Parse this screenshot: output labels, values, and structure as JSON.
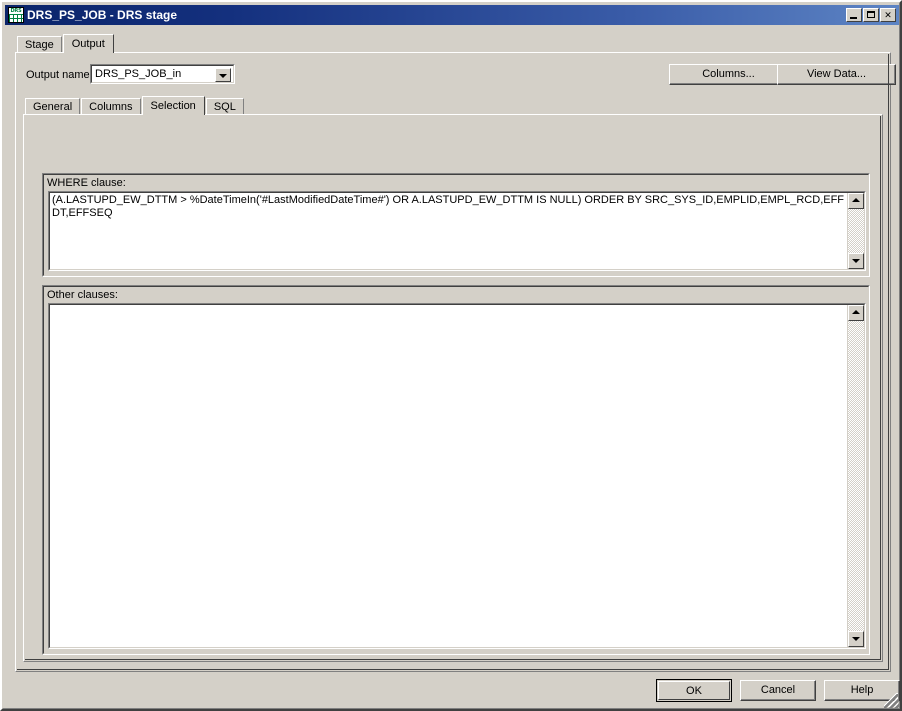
{
  "window": {
    "title": "DRS_PS_JOB - DRS stage",
    "icon": "drs-grid-icon",
    "minimize_label": "Minimize",
    "maximize_label": "Maximize",
    "close_label": "✕"
  },
  "outer_tabs": [
    {
      "label": "Stage",
      "active": false
    },
    {
      "label": "Output",
      "active": true
    }
  ],
  "output_row": {
    "label": "Output name:",
    "combo_value": "DRS_PS_JOB_in",
    "combo_placeholder": "Output name",
    "columns_button": "Columns...",
    "view_data_button": "View Data..."
  },
  "inner_tabs": [
    {
      "label": "General",
      "active": false
    },
    {
      "label": "Columns",
      "active": false
    },
    {
      "label": "Selection",
      "active": true
    },
    {
      "label": "SQL",
      "active": false
    }
  ],
  "where_group": {
    "label": "WHERE clause:",
    "text": "(A.LASTUPD_EW_DTTM > %DateTimeIn('#LastModifiedDateTime#') OR A.LASTUPD_EW_DTTM IS NULL) ORDER BY SRC_SYS_ID,EMPLID,EMPL_RCD,EFFDT,EFFSEQ",
    "placeholder": ""
  },
  "other_group": {
    "label": "Other clauses:",
    "text": "",
    "placeholder": ""
  },
  "footer": {
    "ok_label": "OK",
    "cancel_label": "Cancel",
    "help_label": "Help"
  },
  "colors": {
    "face": "#d4d0c8",
    "title_left": "#0a246a",
    "title_right": "#5d84c4",
    "field_bg": "#ffffff",
    "icon_green": "#008040"
  }
}
